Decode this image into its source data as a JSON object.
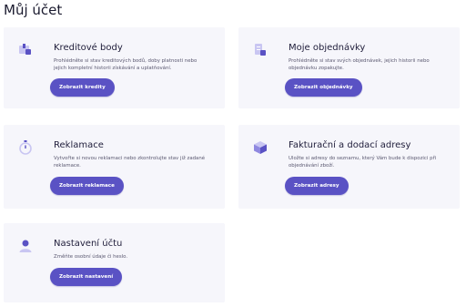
{
  "page": {
    "title": "Můj účet"
  },
  "cards": [
    {
      "title": "Kreditové body",
      "desc": "Prohlédněte si stav kreditových bodů, doby platnosti nebo jejich kompletní historii získávání a uplatňování.",
      "button": "Zobrazit kredity",
      "icon": "credit-card-icon"
    },
    {
      "title": "Moje objednávky",
      "desc": "Prohlédněte si stav svých objednávek, jejich historii nebo objednávku zopakujte.",
      "button": "Zobrazit objednávky",
      "icon": "orders-icon"
    },
    {
      "title": "Reklamace",
      "desc": "Vytvořte si novou reklamaci nebo zkontrolujte stav již zadané reklamace.",
      "button": "Zobrazit reklamace",
      "icon": "stopwatch-icon"
    },
    {
      "title": "Fakturační a dodací adresy",
      "desc": "Uložte si adresy do seznamu, který Vám bude k dispozici při objednávání zboží.",
      "button": "Zobrazit adresy",
      "icon": "package-icon"
    },
    {
      "title": "Nastavení účtu",
      "desc": "Změňte osobní údaje či heslo.",
      "button": "Zobrazit nastavení",
      "icon": "user-icon"
    }
  ],
  "colors": {
    "accent": "#5a52c4",
    "card_bg": "#f6f6fb",
    "icon_light": "#c9c6f2",
    "icon_dark": "#5a52c4"
  }
}
